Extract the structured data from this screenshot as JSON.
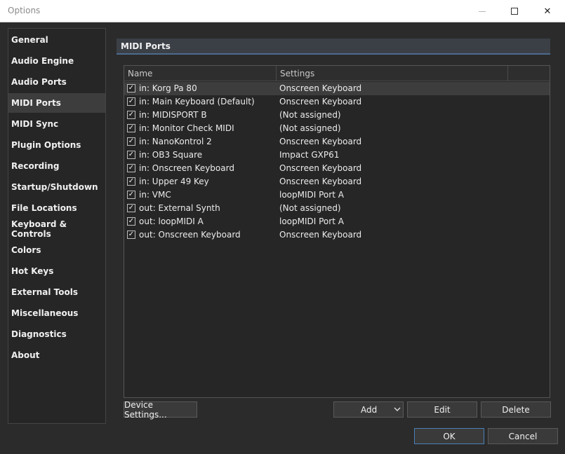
{
  "window": {
    "title": "Options",
    "minimize": "—",
    "maximize": "☐",
    "close": "✕"
  },
  "sidebar": {
    "items": [
      {
        "label": "General"
      },
      {
        "label": "Audio Engine"
      },
      {
        "label": "Audio Ports"
      },
      {
        "label": "MIDI Ports",
        "active": true
      },
      {
        "label": "MIDI Sync"
      },
      {
        "label": "Plugin Options"
      },
      {
        "label": "Recording"
      },
      {
        "label": "Startup/Shutdown"
      },
      {
        "label": "File Locations"
      },
      {
        "label": "Keyboard & Controls"
      },
      {
        "label": "Colors"
      },
      {
        "label": "Hot Keys"
      },
      {
        "label": "External Tools"
      },
      {
        "label": "Miscellaneous"
      },
      {
        "label": "Diagnostics"
      },
      {
        "label": "About"
      }
    ]
  },
  "panel": {
    "title": "MIDI Ports"
  },
  "table": {
    "columns": [
      "Name",
      "Settings"
    ],
    "rows": [
      {
        "checked": true,
        "name": "in: Korg Pa 80",
        "settings": "Onscreen Keyboard",
        "selected": true
      },
      {
        "checked": true,
        "name": "in: Main Keyboard (Default)",
        "settings": "Onscreen Keyboard"
      },
      {
        "checked": true,
        "name": "in: MIDISPORT B",
        "settings": "(Not assigned)"
      },
      {
        "checked": true,
        "name": "in: Monitor Check MIDI",
        "settings": "(Not assigned)"
      },
      {
        "checked": true,
        "name": "in: NanoKontrol 2",
        "settings": "Onscreen Keyboard"
      },
      {
        "checked": true,
        "name": "in: OB3 Square",
        "settings": "Impact GXP61"
      },
      {
        "checked": true,
        "name": "in: Onscreen Keyboard",
        "settings": "Onscreen Keyboard"
      },
      {
        "checked": true,
        "name": "in: Upper 49 Key",
        "settings": "Onscreen Keyboard"
      },
      {
        "checked": true,
        "name": "in: VMC",
        "settings": "loopMIDI Port A"
      },
      {
        "checked": true,
        "name": "out: External Synth",
        "settings": "(Not assigned)"
      },
      {
        "checked": true,
        "name": "out: loopMIDI A",
        "settings": "loopMIDI Port A"
      },
      {
        "checked": true,
        "name": "out: Onscreen Keyboard",
        "settings": "Onscreen Keyboard"
      }
    ]
  },
  "buttons": {
    "device_settings": "Device Settings...",
    "add": "Add",
    "edit": "Edit",
    "delete": "Delete",
    "ok": "OK",
    "cancel": "Cancel"
  },
  "icons": {
    "checkbox": "check-icon",
    "add_dropdown": "chevron-down-icon"
  },
  "colors": {
    "background": "#2b2b2b",
    "header_accent": "#4c6a8c",
    "ok_border": "#4a7fb5"
  }
}
